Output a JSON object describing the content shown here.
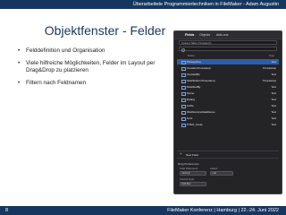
{
  "header": {
    "text": "Überarbeitete Programmiertechniken in FileMaker - Adam Augustin"
  },
  "slide": {
    "title": "Objektfenster - Felder",
    "bullets": [
      "Felddefinition und Organisation",
      "Viele hilfreiche Möglichkeiten, Felder im Layout per Drag&Drop zu platzieren",
      "Filtern nach Feldnamen"
    ]
  },
  "objects_panel": {
    "tabs": [
      "Fields",
      "Objects",
      "Add-ons"
    ],
    "context": "Current Table (\"Unsaved\")",
    "columns": {
      "name": "Name",
      "type": "Type"
    },
    "fields": [
      {
        "name": "PrimaryKey",
        "type": "Text"
      },
      {
        "name": "CreationTimestamp",
        "type": "Timestamp"
      },
      {
        "name": "CreatedBy",
        "type": "Text"
      },
      {
        "name": "ModificationTimestamp",
        "type": "Timestamp"
      },
      {
        "name": "ModifiedBy",
        "type": "Text"
      },
      {
        "name": "Name",
        "type": "Text"
      },
      {
        "name": "Rating",
        "type": "Text"
      },
      {
        "name": "Fehle",
        "type": "Text"
      },
      {
        "name": "WebServiceDataName",
        "type": "Text"
      },
      {
        "name": "Kurz",
        "type": "Text"
      },
      {
        "name": "HTML_Code",
        "type": "Text"
      }
    ],
    "new_field_label": "New Field",
    "drag_prefs": {
      "title": "Drag Preferences",
      "field_placement_label": "Field Placement",
      "labels_label": "Labels",
      "placement_value": "Vertical",
      "labels_value": "Left",
      "control_style_label": "Control Style",
      "control_style_value": "Edit Box"
    }
  },
  "footer": {
    "page": "8",
    "text": "FileMaker Konferenz | Hamburg | 22.-24. Juni 2022"
  }
}
